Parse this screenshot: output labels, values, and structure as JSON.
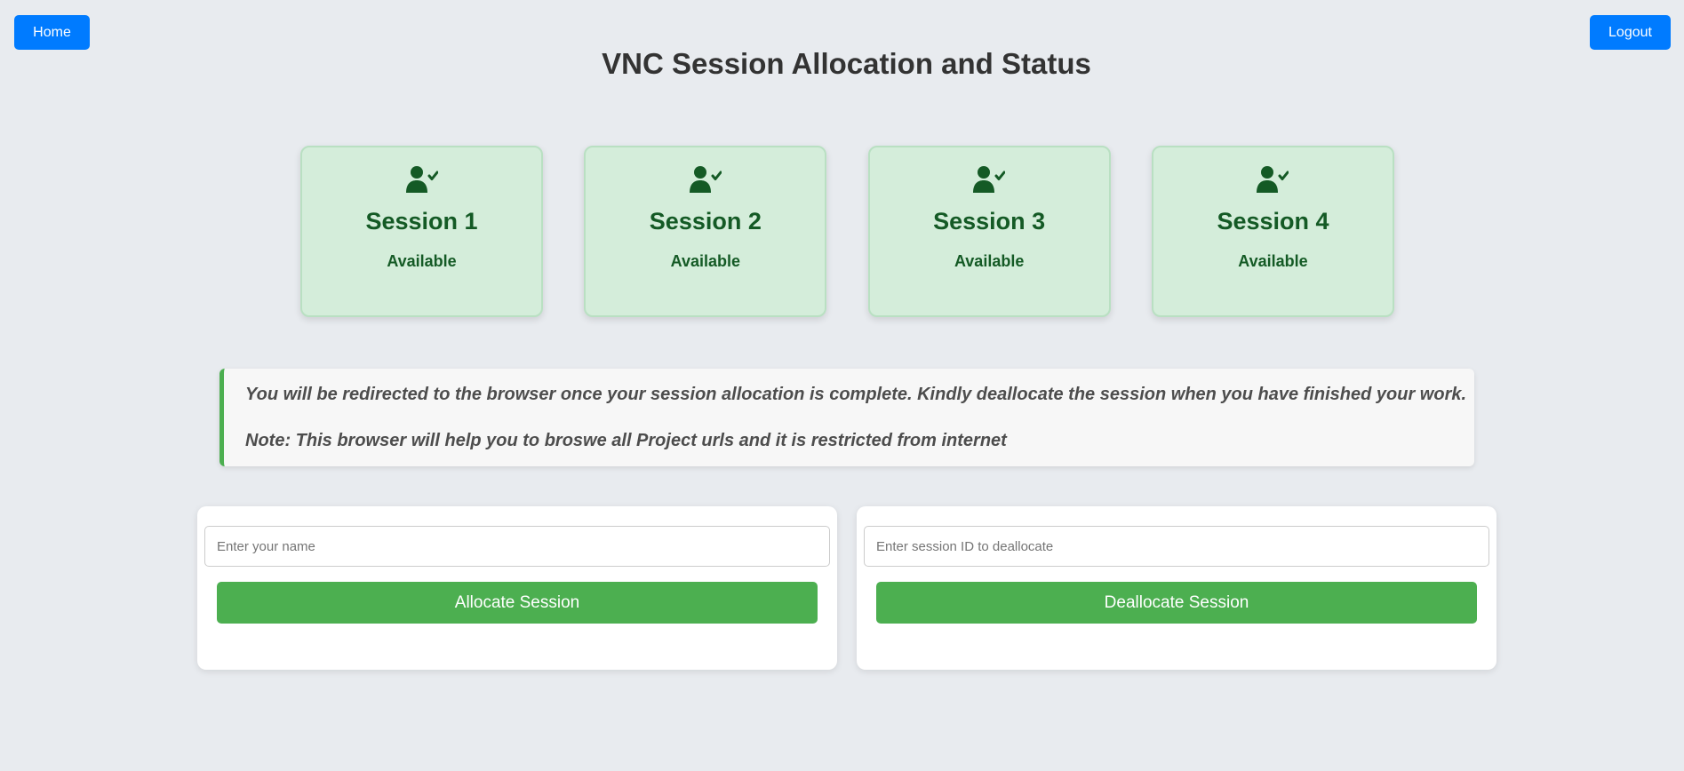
{
  "nav": {
    "home_label": "Home",
    "logout_label": "Logout"
  },
  "page": {
    "title": "VNC Session Allocation and Status"
  },
  "sessions": [
    {
      "name": "Session 1",
      "status": "Available",
      "icon": "user-check-icon"
    },
    {
      "name": "Session 2",
      "status": "Available",
      "icon": "user-check-icon"
    },
    {
      "name": "Session 3",
      "status": "Available",
      "icon": "user-check-icon"
    },
    {
      "name": "Session 4",
      "status": "Available",
      "icon": "user-check-icon"
    }
  ],
  "notice": {
    "line1": "You will be redirected to the browser once your session allocation is complete. Kindly deallocate the session when you have finished your work.",
    "line2": "Note: This browser will help you to broswe all Project urls and it is restricted from internet"
  },
  "allocate": {
    "placeholder": "Enter your name",
    "value": "",
    "button_label": "Allocate Session"
  },
  "deallocate": {
    "placeholder": "Enter session ID to deallocate",
    "value": "",
    "button_label": "Deallocate Session"
  },
  "colors": {
    "background": "#e8ebef",
    "nav_button": "#007bff",
    "session_card": "#d4edda",
    "session_text": "#145a25",
    "action_button": "#4caf50",
    "notice_accent": "#4caf50"
  }
}
